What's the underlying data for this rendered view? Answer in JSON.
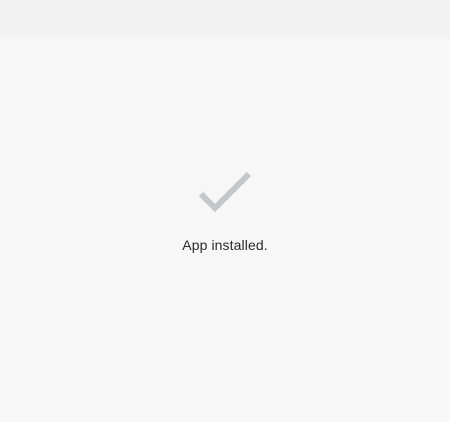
{
  "status": {
    "icon": "check-icon",
    "icon_color": "#c3c9cb",
    "message": "App installed."
  }
}
